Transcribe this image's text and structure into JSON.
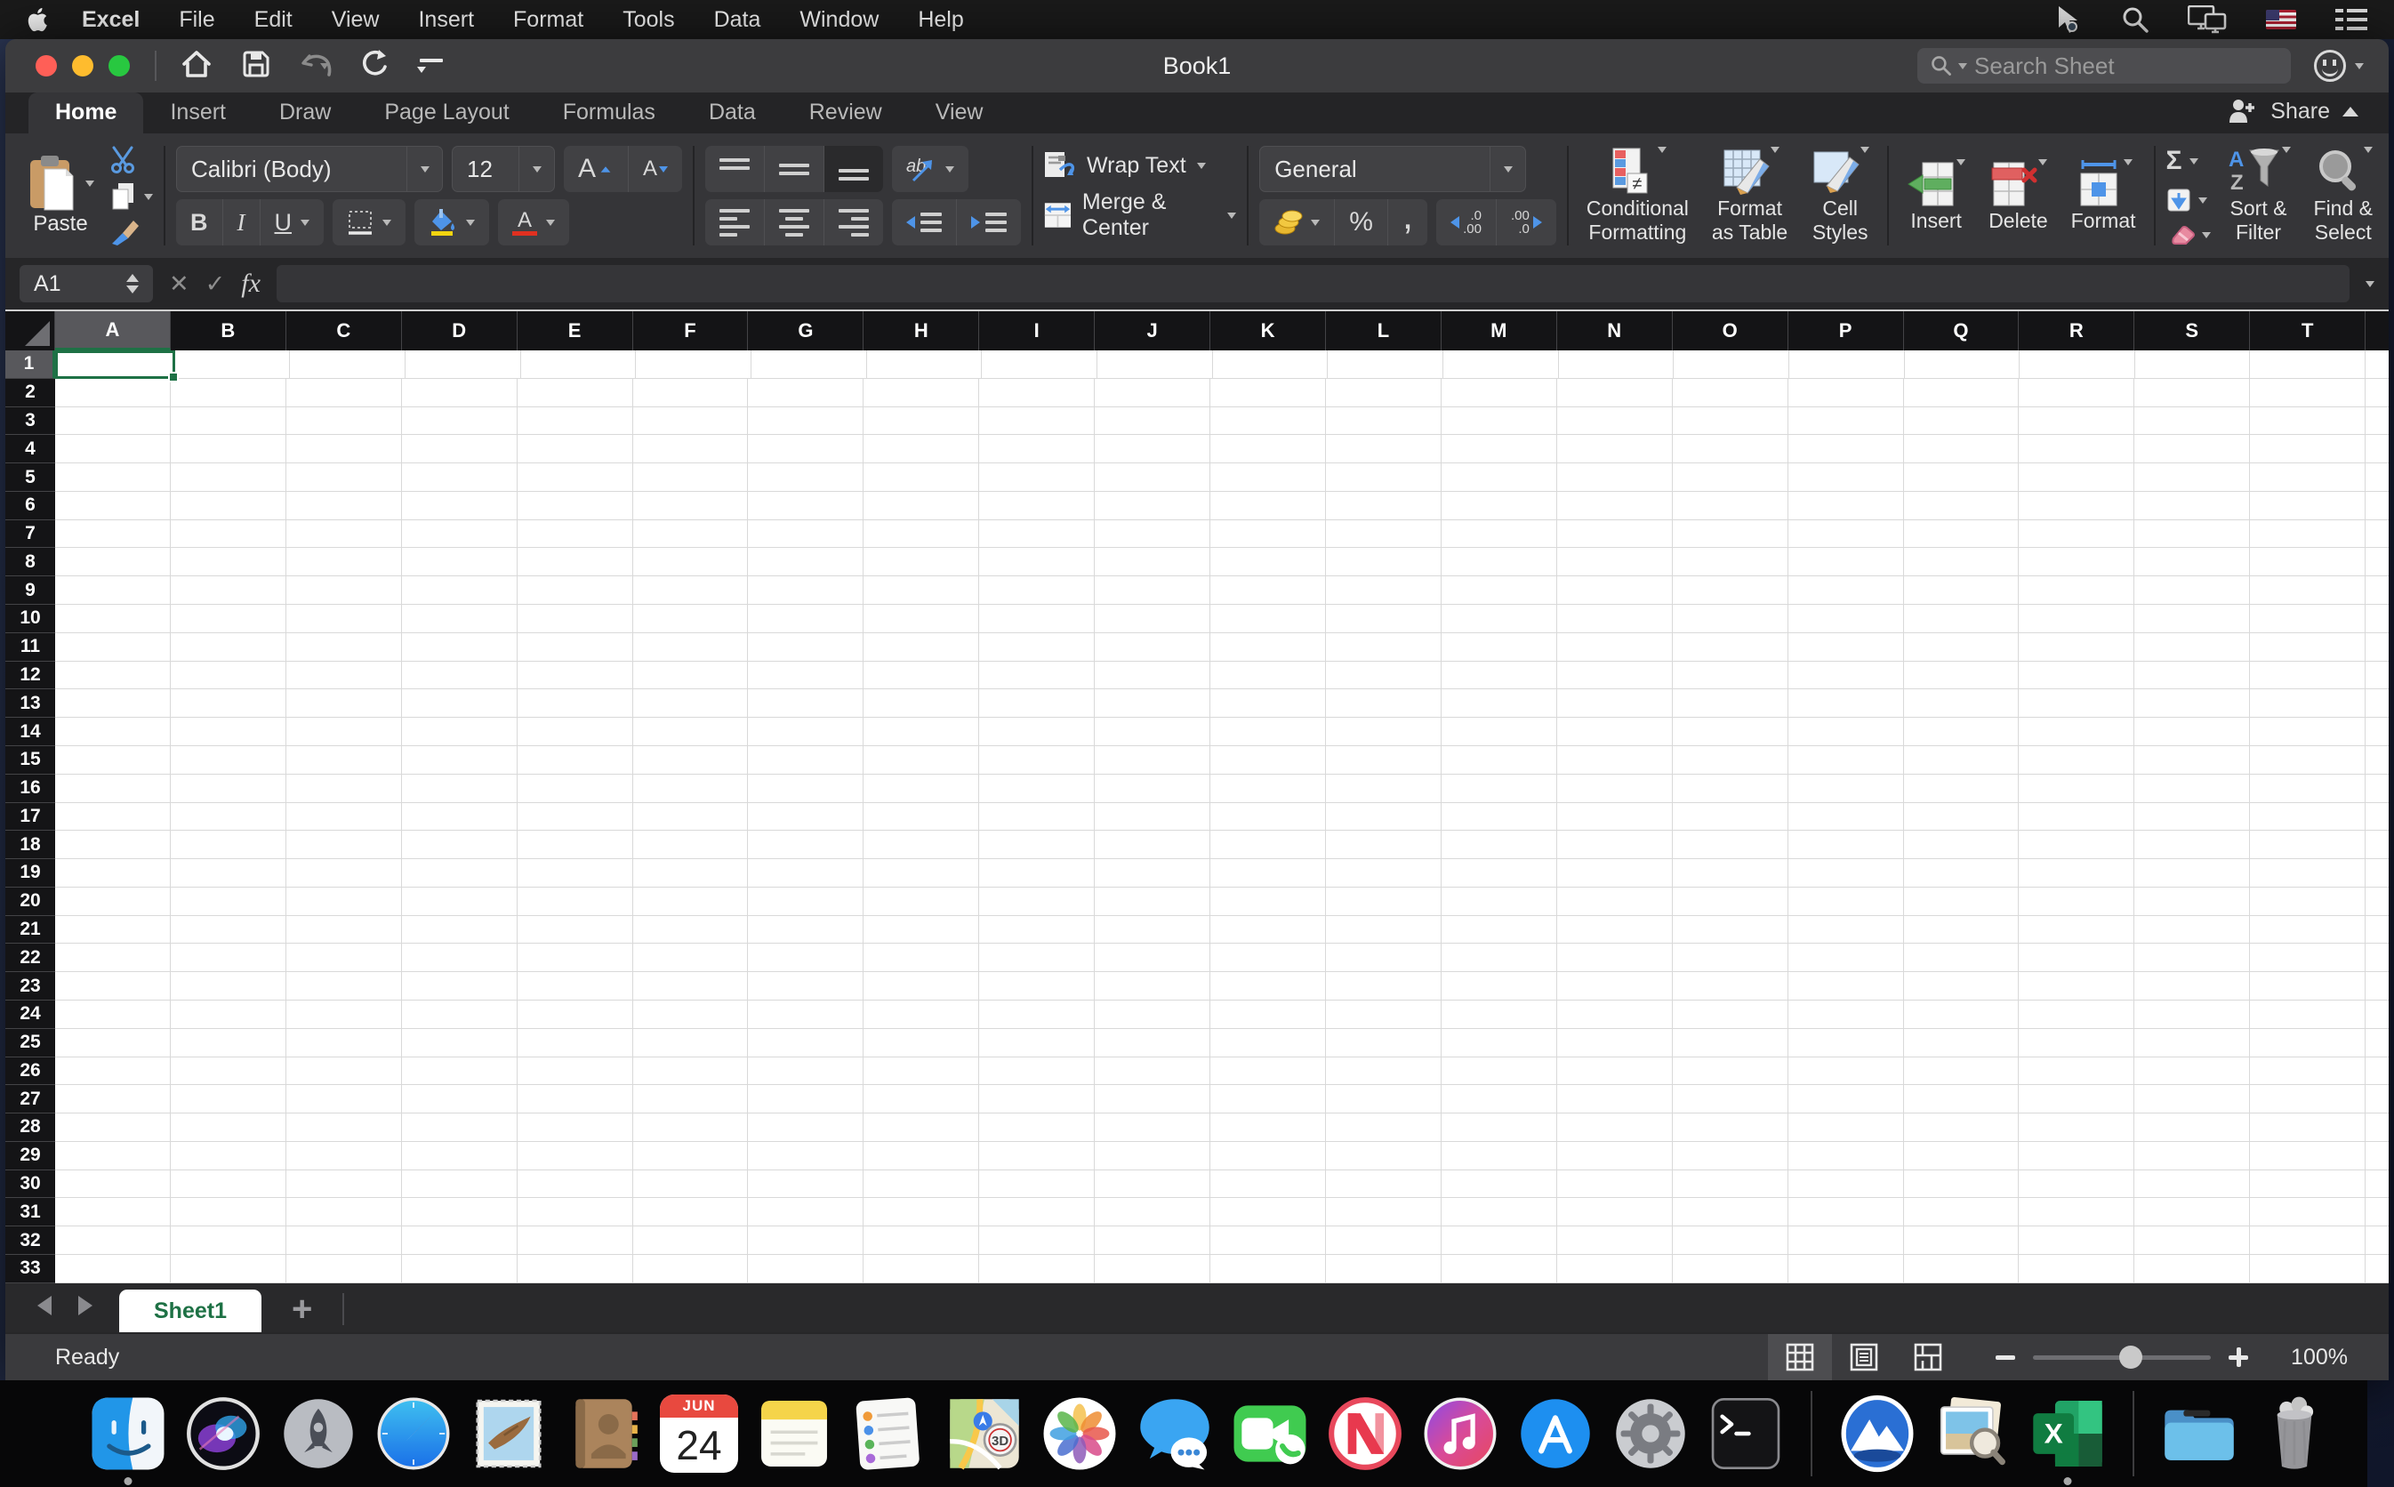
{
  "menu_bar": {
    "app_name": "Excel",
    "items": [
      "File",
      "Edit",
      "View",
      "Insert",
      "Format",
      "Tools",
      "Data",
      "Window",
      "Help"
    ],
    "status_icons": [
      "pointer-icon",
      "search-icon",
      "displays-icon",
      "us-flag-icon",
      "list-icon"
    ]
  },
  "title_bar": {
    "title": "Book1",
    "search_placeholder": "Search Sheet",
    "quick_access_icons": [
      "home-icon",
      "save-icon",
      "undo-icon",
      "redo-icon",
      "customize-toolbar-icon"
    ]
  },
  "ribbon": {
    "tabs": [
      "Home",
      "Insert",
      "Draw",
      "Page Layout",
      "Formulas",
      "Data",
      "Review",
      "View"
    ],
    "active_tab": "Home",
    "share_label": "Share",
    "clipboard": {
      "paste_label": "Paste"
    },
    "font": {
      "family": "Calibri (Body)",
      "size": "12"
    },
    "alignment": {
      "wrap_text_label": "Wrap Text",
      "merge_center_label": "Merge & Center"
    },
    "number": {
      "format": "General",
      "percent_symbol": "%",
      "comma_symbol": ",",
      "inc_dec_top": ".0",
      "inc_dec_bottom": ".00",
      "dec_dec_top": ".00",
      "dec_dec_bottom": ".0"
    },
    "styles": {
      "conditional_line1": "Conditional",
      "conditional_line2": "Formatting",
      "table_line1": "Format",
      "table_line2": "as Table",
      "cell_line1": "Cell",
      "cell_line2": "Styles"
    },
    "cells": {
      "insert_label": "Insert",
      "delete_label": "Delete",
      "format_label": "Format"
    },
    "editing": {
      "autosum_symbol": "Σ",
      "sort_line1": "Sort &",
      "sort_line2": "Filter",
      "find_line1": "Find &",
      "find_line2": "Select"
    }
  },
  "formula_bar": {
    "name_box": "A1",
    "formula_value": "",
    "fx_label": "fx"
  },
  "grid": {
    "columns": [
      "A",
      "B",
      "C",
      "D",
      "E",
      "F",
      "G",
      "H",
      "I",
      "J",
      "K",
      "L",
      "M",
      "N",
      "O",
      "P",
      "Q",
      "R",
      "S",
      "T"
    ],
    "row_count": 33,
    "selected_cell": "A1"
  },
  "sheet_tabs": {
    "active_tab": "Sheet1",
    "add_label": "+"
  },
  "status_bar": {
    "status": "Ready",
    "zoom_level": "100%",
    "zoom_percent": 55,
    "view_icons": [
      "normal-view-icon",
      "page-layout-view-icon",
      "page-break-view-icon"
    ]
  },
  "dock": {
    "items": [
      {
        "name": "finder",
        "running": true
      },
      {
        "name": "siri"
      },
      {
        "name": "launchpad"
      },
      {
        "name": "safari"
      },
      {
        "name": "mail"
      },
      {
        "name": "contacts"
      },
      {
        "name": "calendar",
        "line1": "JUN",
        "line2": "24"
      },
      {
        "name": "notes"
      },
      {
        "name": "reminders"
      },
      {
        "name": "maps",
        "badge": "3D"
      },
      {
        "name": "photos"
      },
      {
        "name": "messages"
      },
      {
        "name": "facetime"
      },
      {
        "name": "news"
      },
      {
        "name": "itunes"
      },
      {
        "name": "app-store"
      },
      {
        "name": "system-preferences"
      },
      {
        "name": "terminal"
      },
      {
        "name": "separator"
      },
      {
        "name": "mountain-app"
      },
      {
        "name": "preview"
      },
      {
        "name": "excel",
        "running": true
      },
      {
        "name": "separator"
      },
      {
        "name": "downloads-folder"
      },
      {
        "name": "trash"
      }
    ]
  },
  "colors": {
    "excel_green": "#1E7145",
    "traffic_red": "#FF5F57",
    "traffic_yellow": "#FEBC2E",
    "traffic_green": "#28C840",
    "cell_grid_line": "#D9D9D9"
  }
}
